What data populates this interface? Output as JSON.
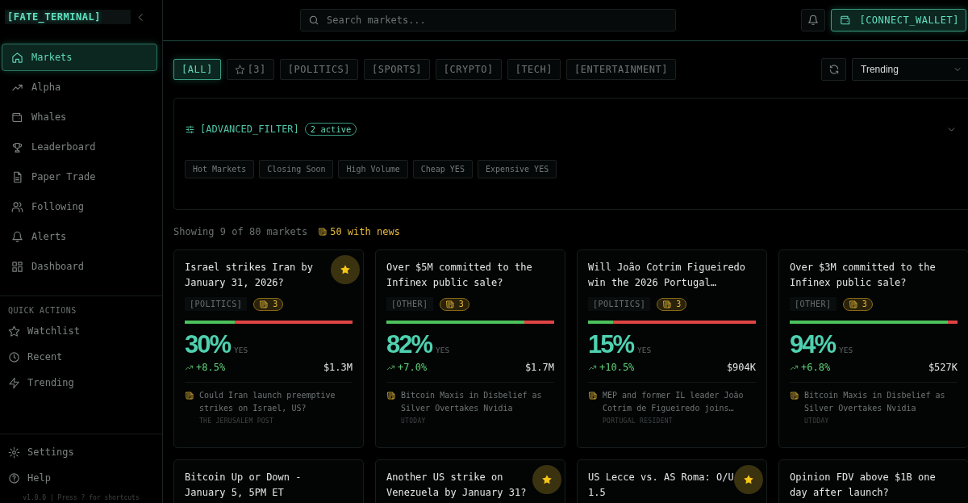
{
  "sidebar": {
    "logo": "[FATE_TERMINAL]",
    "nav": [
      {
        "label": "Markets",
        "selected": true
      },
      {
        "label": "Alpha",
        "selected": false
      },
      {
        "label": "Whales",
        "selected": false
      },
      {
        "label": "Leaderboard",
        "selected": false
      },
      {
        "label": "Paper Trade",
        "selected": false
      },
      {
        "label": "Following",
        "selected": false
      },
      {
        "label": "Alerts",
        "selected": false
      },
      {
        "label": "Dashboard",
        "selected": false
      }
    ],
    "quick_actions_title": "QUICK ACTIONS",
    "quick_actions": [
      "Watchlist",
      "Recent",
      "Trending"
    ],
    "footer": [
      "Settings",
      "Help"
    ],
    "version": "v1.0.0 | Press ? for shortcuts"
  },
  "header": {
    "search": {
      "placeholder": "Search markets..."
    },
    "wallet_button": "[CONNECT_WALLET]"
  },
  "filters": [
    {
      "label": "[ALL]",
      "selected": true,
      "kind": "text"
    },
    {
      "label": "[3]",
      "selected": false,
      "kind": "starred"
    },
    {
      "label": "[POLITICS]",
      "selected": false,
      "kind": "text"
    },
    {
      "label": "[SPORTS]",
      "selected": false,
      "kind": "text"
    },
    {
      "label": "[CRYPTO]",
      "selected": false,
      "kind": "text"
    },
    {
      "label": "[TECH]",
      "selected": false,
      "kind": "text"
    },
    {
      "label": "[ENTERTAINMENT]",
      "selected": false,
      "kind": "text"
    }
  ],
  "sort": {
    "value": "Trending"
  },
  "advanced_filter": {
    "title": "[ADVANCED_FILTER]",
    "badge": "2 active",
    "presets": [
      "Hot Markets",
      "Closing Soon",
      "High Volume",
      "Cheap YES",
      "Expensive YES"
    ]
  },
  "summary": {
    "showing": "Showing 9 of 80 markets",
    "news": "50 with news"
  },
  "cards": [
    {
      "title": "Israel strikes Iran by January 31, 2026?",
      "starred": true,
      "category": "[POLITICS]",
      "news_count": "3",
      "level": 0.3,
      "percent": "30%",
      "outcome": "YES",
      "change": "+8.5%",
      "volume": "$1.3M",
      "headline": "Could Iran launch preemptive strikes on Israel, US?",
      "source": "THE JERUSALEM POST"
    },
    {
      "title": "Over $5M committed to the Infinex public sale?",
      "starred": false,
      "category": "[OTHER]",
      "news_count": "3",
      "level": 0.82,
      "percent": "82%",
      "outcome": "YES",
      "change": "+7.0%",
      "volume": "$1.7M",
      "headline": "Bitcoin Maxis in Disbelief as Silver Overtakes Nvidia",
      "source": "UTODAY"
    },
    {
      "title": "Will João Cotrim Figueiredo win the 2026 Portugal…",
      "starred": false,
      "category": "[POLITICS]",
      "news_count": "3",
      "level": 0.15,
      "percent": "15%",
      "outcome": "YES",
      "change": "+10.5%",
      "volume": "$904K",
      "headline": "MEP and former IL leader João Cotrim de Figueiredo joins…",
      "source": "PORTUGAL RESIDENT"
    },
    {
      "title": "Over $3M committed to the Infinex public sale?",
      "starred": false,
      "category": "[OTHER]",
      "news_count": "3",
      "level": 0.94,
      "percent": "94%",
      "outcome": "YES",
      "change": "+6.8%",
      "volume": "$527K",
      "headline": "Bitcoin Maxis in Disbelief as Silver Overtakes Nvidia",
      "source": "UTODAY"
    },
    {
      "title": "Bitcoin Up or Down - January 5, 5PM ET",
      "starred": false
    },
    {
      "title": "Another US strike on Venezuela by January 31?",
      "starred": true
    },
    {
      "title": "US Lecce vs. AS Roma: O/U 1.5",
      "starred": true
    },
    {
      "title": "Opinion FDV above $1B one day after launch?",
      "starred": false
    }
  ]
}
